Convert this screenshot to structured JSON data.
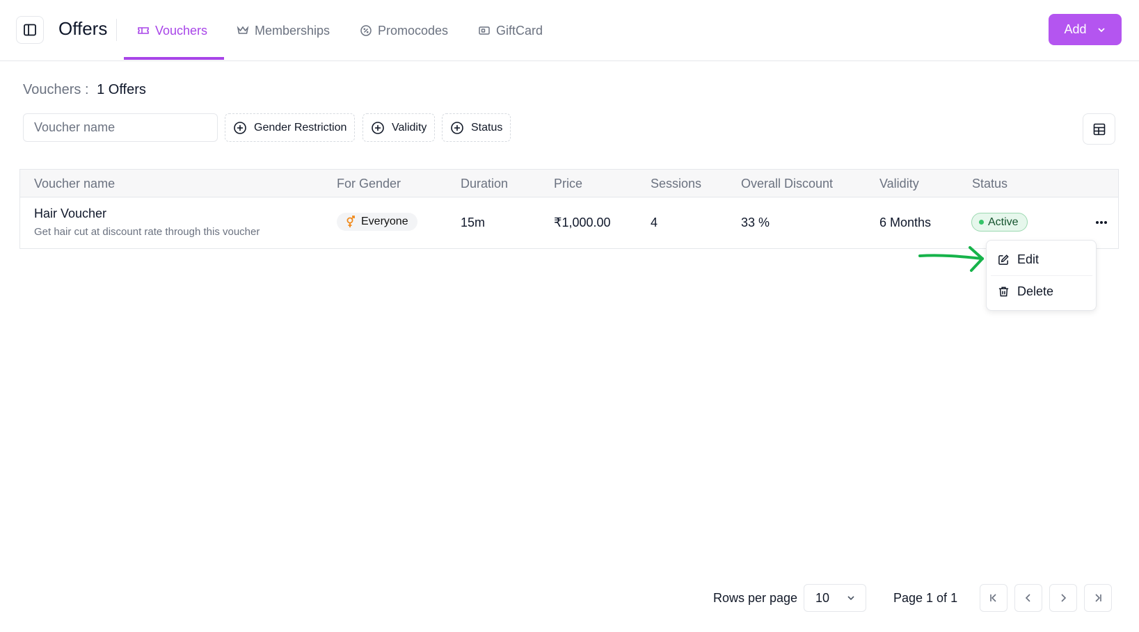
{
  "header": {
    "title": "Offers",
    "tabs": [
      {
        "label": "Vouchers",
        "icon": "ticket-icon",
        "active": true
      },
      {
        "label": "Memberships",
        "icon": "crown-icon",
        "active": false
      },
      {
        "label": "Promocodes",
        "icon": "badge-percent-icon",
        "active": false
      },
      {
        "label": "GiftCard",
        "icon": "gift-card-icon",
        "active": false
      }
    ],
    "add_label": "Add"
  },
  "summary": {
    "label": "Vouchers :",
    "count": "1 Offers"
  },
  "filters": {
    "search_placeholder": "Voucher name",
    "buttons": [
      "Gender Restriction",
      "Validity",
      "Status"
    ]
  },
  "table": {
    "columns": [
      "Voucher name",
      "For Gender",
      "Duration",
      "Price",
      "Sessions",
      "Overall Discount",
      "Validity",
      "Status"
    ],
    "rows": [
      {
        "name": "Hair Voucher",
        "description": "Get hair cut at discount rate through this voucher",
        "gender": "Everyone",
        "duration": "15m",
        "price": "₹1,000.00",
        "sessions": "4",
        "discount": "33 %",
        "validity": "6 Months",
        "status": "Active"
      }
    ]
  },
  "row_menu": {
    "edit_label": "Edit",
    "delete_label": "Delete"
  },
  "pagination": {
    "rows_per_page_label": "Rows per page",
    "rows_per_page_value": "10",
    "page_label": "Page 1 of 1"
  },
  "colors": {
    "accent": "#a845e8",
    "add_button": "#b455f0",
    "active_status": "#34c468",
    "arrow": "#16b34a"
  }
}
